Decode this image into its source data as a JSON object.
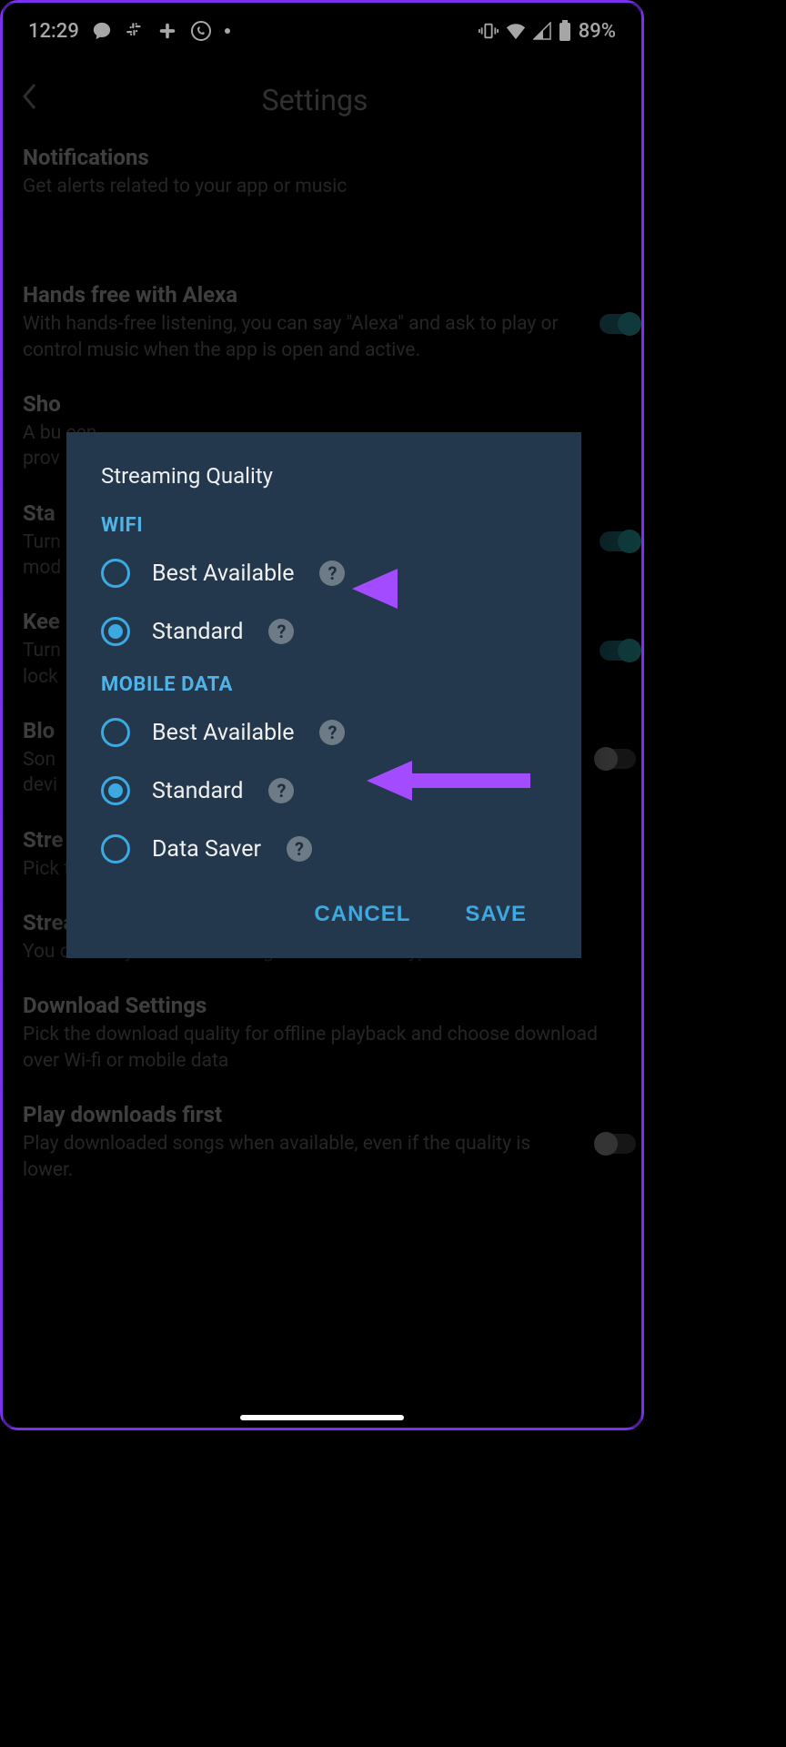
{
  "status_bar": {
    "time": "12:29",
    "battery_percent": "89%"
  },
  "header": {
    "title": "Settings"
  },
  "settings": [
    {
      "title": "Notifications",
      "desc": "Get alerts related to your app or music",
      "toggle": null,
      "gap_after": true
    },
    {
      "title": "Hands free with Alexa",
      "desc": "With hands-free listening, you can say \"Alexa\" and ask to play or control music when the app is open and active.",
      "toggle": "on"
    },
    {
      "title": "Sho",
      "desc": "A bu                                                                                    een\nprov",
      "toggle": null
    },
    {
      "title": "Sta",
      "desc": "Turn\nmod",
      "toggle": "on"
    },
    {
      "title": "Kee",
      "desc": "Turn\nlock",
      "toggle": "on"
    },
    {
      "title": "Blo",
      "desc": "Son\ndevi",
      "toggle": "off"
    },
    {
      "title": "Stre",
      "desc": "Pick the streaming audio quality for Wi-fi and mobile data",
      "toggle": null
    },
    {
      "title": "Streaming Network Preference",
      "desc": "You currently allow streaming on all network types.",
      "toggle": null
    },
    {
      "title": "Download Settings",
      "desc": "Pick the download quality for offline playback and choose download over Wi-fi or mobile data",
      "toggle": null
    },
    {
      "title": "Play downloads first",
      "desc": "Play downloaded songs when available, even if the quality is lower.",
      "toggle": "off"
    }
  ],
  "dialog": {
    "title": "Streaming Quality",
    "sections": [
      {
        "label": "WIFI",
        "options": [
          {
            "label": "Best Available",
            "selected": false,
            "help": true
          },
          {
            "label": "Standard",
            "selected": true,
            "help": true
          }
        ]
      },
      {
        "label": "MOBILE DATA",
        "options": [
          {
            "label": "Best Available",
            "selected": false,
            "help": true
          },
          {
            "label": "Standard",
            "selected": true,
            "help": true
          },
          {
            "label": "Data Saver",
            "selected": false,
            "help": true
          }
        ]
      }
    ],
    "cancel": "CANCEL",
    "save": "SAVE"
  }
}
